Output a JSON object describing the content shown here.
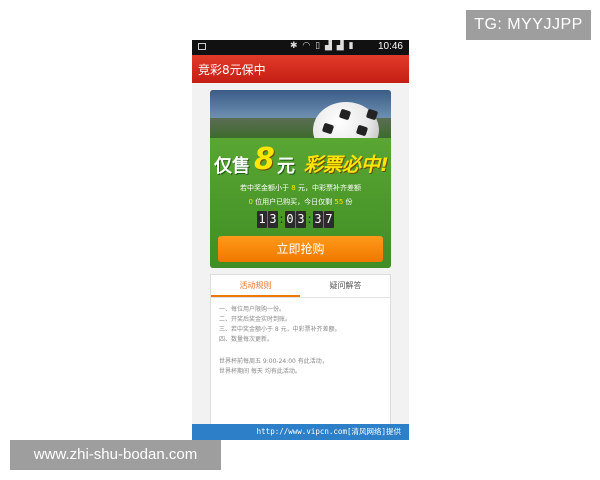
{
  "watermarks": {
    "top_right": "TG: MYYJJPP",
    "bottom_left": "www.zhi-shu-bodan.com"
  },
  "status_bar": {
    "time": "10:46",
    "icons": [
      "image-icon",
      "bluetooth-icon",
      "wifi-icon",
      "vibrate-icon",
      "4g-signal-icon",
      "signal-icon",
      "battery-icon"
    ]
  },
  "app": {
    "title": "竞彩8元保中"
  },
  "banner": {
    "headline_prefix": "仅售",
    "headline_number": "8",
    "headline_unit": "元",
    "headline_suffix": "彩票必中!",
    "line1_before": "若中奖金额小于",
    "line1_amount": "8",
    "line1_after": "元，中彩票补齐差额",
    "line2_count": "0",
    "line2_middle": "位用户已购买，今日仅剩",
    "line2_remaining": "55",
    "line2_unit": "份",
    "countdown": {
      "h1": "1",
      "h2": "3",
      "m1": "0",
      "m2": "3",
      "s1": "3",
      "s2": "7"
    },
    "buy_button": "立即抢购"
  },
  "tabs": [
    {
      "label": "活动规则",
      "active": true
    },
    {
      "label": "疑问解答",
      "active": false
    }
  ],
  "rules": [
    "一、每位用户限购一份。",
    "二、开奖后奖金实时到账。",
    "三、若中奖金额小于 8 元，中彩票补齐差额。",
    "四、数量每次更新。"
  ],
  "notes": [
    "世界杯前每周五 9:00-24:00 有此活动，",
    "世界杯期间 每天 均有此活动。"
  ],
  "footer": {
    "text": "http://www.vipcn.com[清风网络]提供"
  },
  "colors": {
    "title_bar": "#d42b1e",
    "buy_button": "#f58a0b",
    "active_tab": "#f07800",
    "footer": "#2d7fc8",
    "highlight": "#ffe600"
  }
}
